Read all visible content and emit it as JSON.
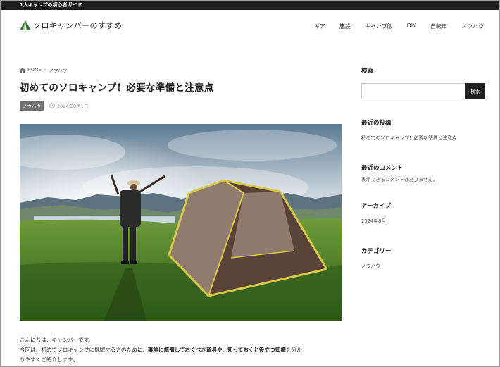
{
  "topbar": {
    "text": "1人キャンプの初心者ガイド"
  },
  "site": {
    "logo_text": "ソロキャンパーのすすめ",
    "accent": "#2f6b3a",
    "accent_light": "#9acb7a"
  },
  "nav": {
    "items": [
      "ギア",
      "施設",
      "キャンプ飯",
      "DIY",
      "自転車",
      "ノウハウ"
    ]
  },
  "breadcrumb": {
    "home": "HOME",
    "current": "ノウハウ"
  },
  "post": {
    "title": "初めてのソロキャンプ！必要な準備と注意点",
    "category": "ノウハウ",
    "date": "2024年8月1日",
    "body_line1": "こんにちは、キャンパーです。",
    "body_line2_pre": "今回は、初めてソロキャンプに挑戦する方のために、",
    "body_line2_bold": "事前に準備しておくべき道具や、知っておくと役立つ知識",
    "body_line2_post": "を分か",
    "body_line3": "りやすくご紹介します。"
  },
  "sidebar": {
    "search_title": "検索",
    "search_placeholder": "",
    "search_button": "検索",
    "recent_posts_title": "最近の投稿",
    "recent_posts": [
      "初めてのソロキャンプ！必要な準備と注意点"
    ],
    "recent_comments_title": "最近のコメント",
    "recent_comments_empty": "表示できるコメントはありません。",
    "archives_title": "アーカイブ",
    "archives": [
      "2024年8月"
    ],
    "categories_title": "カテゴリー",
    "categories": [
      "ノウハウ"
    ]
  },
  "icons": {
    "logo": "tent-logo-icon",
    "home": "home-icon",
    "crumb_sep": "chevron-right-icon",
    "clock": "clock-icon"
  }
}
